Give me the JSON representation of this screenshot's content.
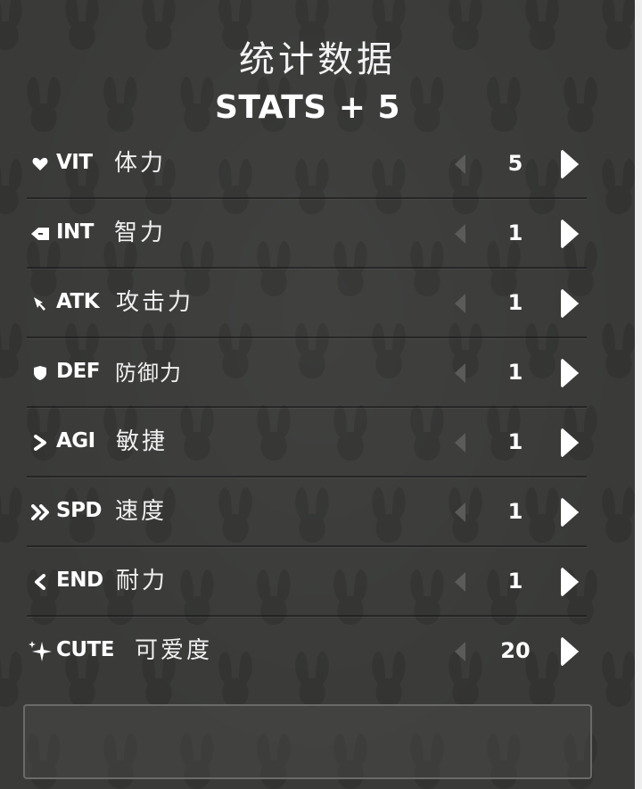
{
  "title": "统计数据",
  "subtitle": "STATS + 5",
  "stats": [
    {
      "abbr": "VIT",
      "cn": "体力",
      "value": "5",
      "icon": "heart-icon"
    },
    {
      "abbr": "INT",
      "cn": "智力",
      "value": "1",
      "icon": "brain-icon"
    },
    {
      "abbr": "ATK",
      "cn": "攻击力",
      "value": "1",
      "icon": "sword-icon"
    },
    {
      "abbr": "DEF",
      "cn": "防御力",
      "value": "1",
      "icon": "shield-icon"
    },
    {
      "abbr": "AGI",
      "cn": "敏捷",
      "value": "1",
      "icon": "chevron-right-icon"
    },
    {
      "abbr": "SPD",
      "cn": "速度",
      "value": "1",
      "icon": "double-chevron-icon"
    },
    {
      "abbr": "END",
      "cn": "耐力",
      "value": "1",
      "icon": "chevron-left-icon"
    },
    {
      "abbr": "CUTE",
      "cn": "可爱度",
      "value": "20",
      "icon": "sparkle-icon"
    }
  ],
  "colors": {
    "background": "#3a3b39",
    "text": "#ffffff",
    "arrow_disabled": "#5a5b59",
    "arrow_active": "#ffffff"
  }
}
